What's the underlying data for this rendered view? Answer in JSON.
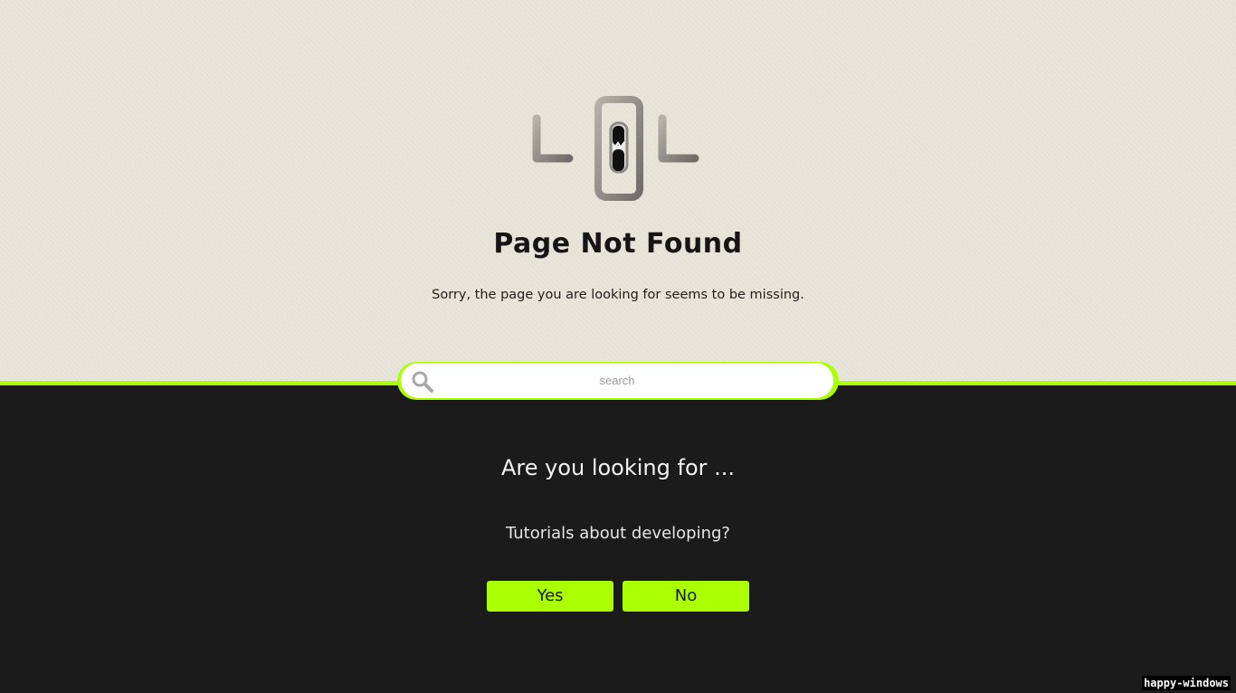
{
  "logo": {
    "digits": [
      "4",
      "0",
      "4"
    ],
    "icon": "broken-chain-link-icon"
  },
  "header": {
    "title": "Page Not Found",
    "subtitle": "Sorry, the page you are looking for seems to be missing."
  },
  "search": {
    "placeholder": "search",
    "value": "",
    "icon": "search-icon"
  },
  "suggestion": {
    "heading": "Are you looking for ...",
    "question": "Tutorials about developing?",
    "yes_label": "Yes",
    "no_label": "No"
  },
  "watermark": {
    "text": "happy-windows"
  },
  "colors": {
    "accent": "#aaff00",
    "top_background": "#e8e5d9",
    "bottom_background": "#1b1b1b"
  }
}
